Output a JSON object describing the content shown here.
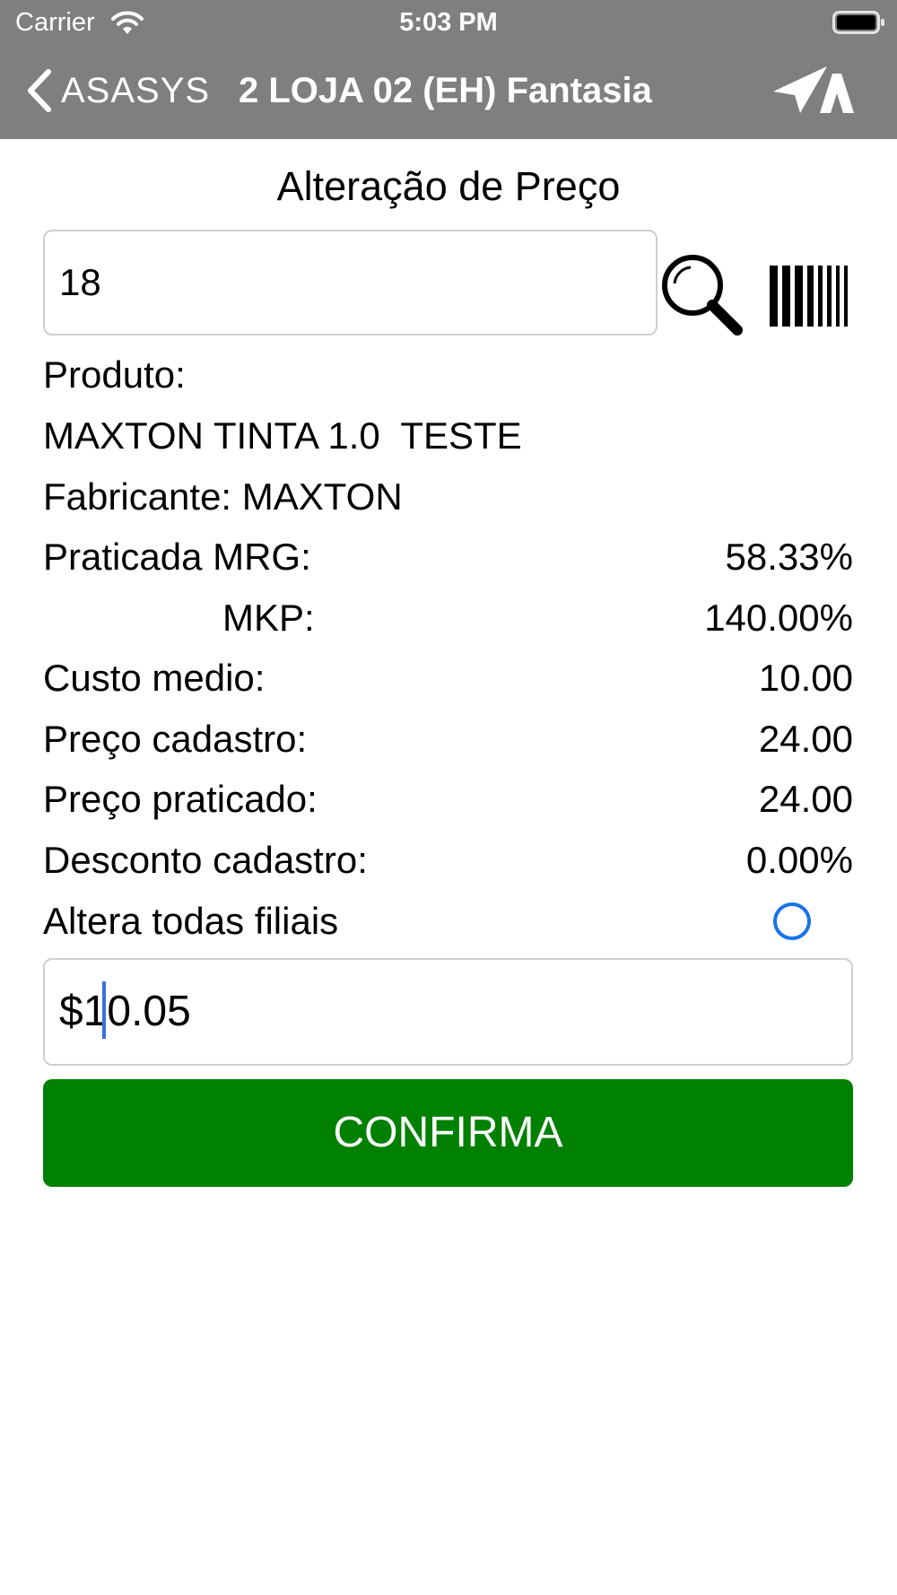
{
  "status_bar": {
    "carrier": "Carrier",
    "time": "5:03 PM"
  },
  "nav": {
    "back_label": "ASASYS",
    "title": "2 LOJA 02 (EH) Fantasia"
  },
  "page": {
    "title": "Alteração de Preço"
  },
  "search": {
    "value": "18"
  },
  "product": {
    "label": "Produto:",
    "name": "MAXTON TINTA 1.0  TESTE",
    "manufacturer": "Fabricante: MAXTON"
  },
  "details": [
    {
      "label": "Praticada MRG:",
      "value": "58.33%"
    },
    {
      "label": "MKP:",
      "value": "140.00%"
    },
    {
      "label": "Custo medio:",
      "value": "10.00"
    },
    {
      "label": "Preço cadastro:",
      "value": "24.00"
    },
    {
      "label": "Preço praticado:",
      "value": "24.00"
    },
    {
      "label": "Desconto cadastro:",
      "value": "0.00%"
    }
  ],
  "all_branches": {
    "label": "Altera todas filiais",
    "checked": false
  },
  "price_input": {
    "value": "$10.05"
  },
  "confirm": {
    "label": "CONFIRMA",
    "color": "#008000"
  },
  "colors": {
    "header": "#7f7f7f",
    "accent": "#1a73e8"
  }
}
